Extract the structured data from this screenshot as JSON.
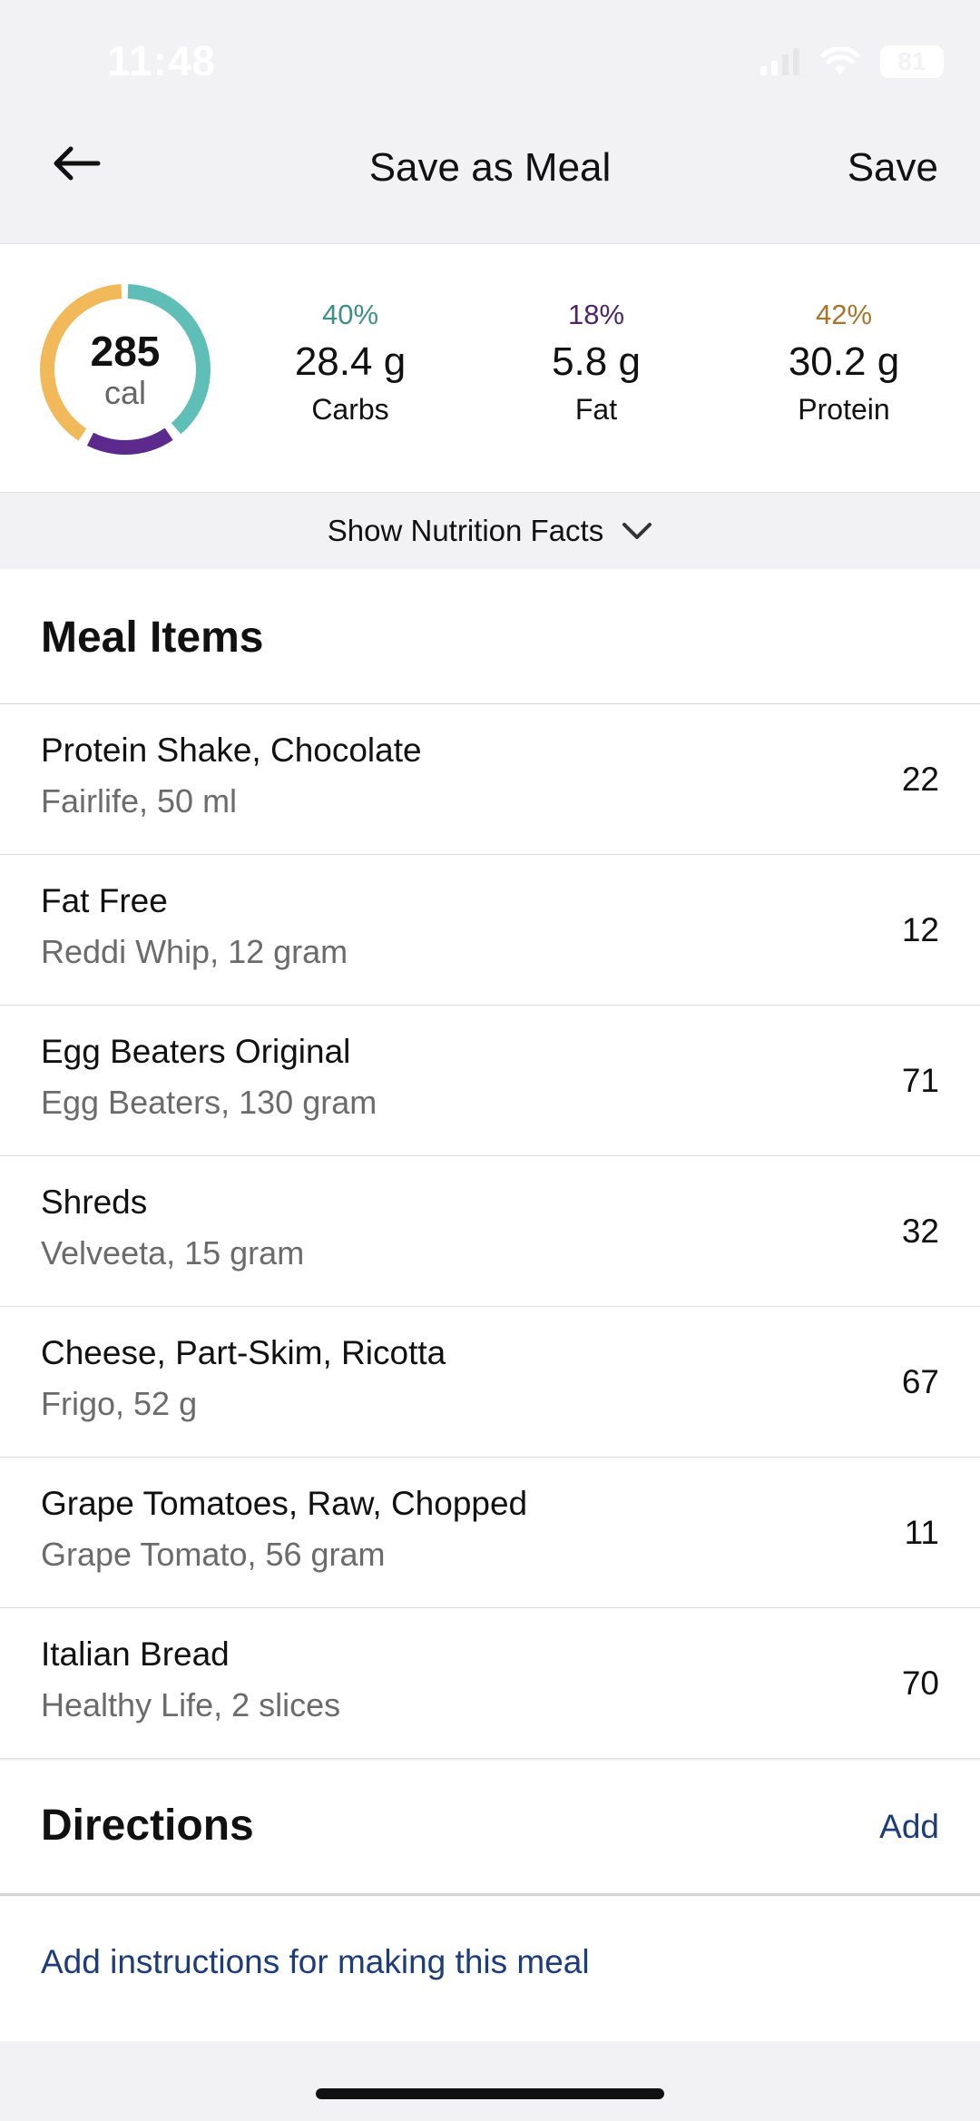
{
  "status": {
    "time": "11:48",
    "battery": "81"
  },
  "nav": {
    "title": "Save as Meal",
    "save": "Save"
  },
  "summary": {
    "calories": "285",
    "calories_unit": "cal",
    "macros": [
      {
        "percent": "40%",
        "amount": "28.4 g",
        "label": "Carbs",
        "color": "#3e8f86"
      },
      {
        "percent": "18%",
        "amount": "5.8 g",
        "label": "Fat",
        "color": "#4f2469"
      },
      {
        "percent": "42%",
        "amount": "30.2 g",
        "label": "Protein",
        "color": "#a8742a"
      }
    ],
    "ring_colors": {
      "carbs": "#5fbfb6",
      "fat": "#5b2a8c",
      "protein": "#f2b95a"
    }
  },
  "nutrition_toggle": {
    "label": "Show Nutrition Facts"
  },
  "meal_items": {
    "title": "Meal Items",
    "items": [
      {
        "name": "Protein Shake, Chocolate",
        "detail": "Fairlife, 50 ml",
        "calories": "22"
      },
      {
        "name": "Fat Free",
        "detail": "Reddi Whip, 12 gram",
        "calories": "12"
      },
      {
        "name": "Egg Beaters Original",
        "detail": "Egg Beaters, 130 gram",
        "calories": "71"
      },
      {
        "name": "Shreds",
        "detail": "Velveeta, 15 gram",
        "calories": "32"
      },
      {
        "name": "Cheese, Part-Skim, Ricotta",
        "detail": "Frigo, 52 g",
        "calories": "67"
      },
      {
        "name": "Grape Tomatoes, Raw, Chopped",
        "detail": "Grape Tomato, 56 gram",
        "calories": "11"
      },
      {
        "name": "Italian Bread",
        "detail": "Healthy Life, 2 slices",
        "calories": "70"
      }
    ]
  },
  "directions": {
    "title": "Directions",
    "add": "Add",
    "placeholder": "Add instructions for making this meal"
  },
  "icons": {
    "back": "arrow-left-icon",
    "chevron": "chevron-down-icon",
    "signal": "cellular-signal-icon",
    "wifi": "wifi-icon",
    "battery": "battery-icon"
  }
}
